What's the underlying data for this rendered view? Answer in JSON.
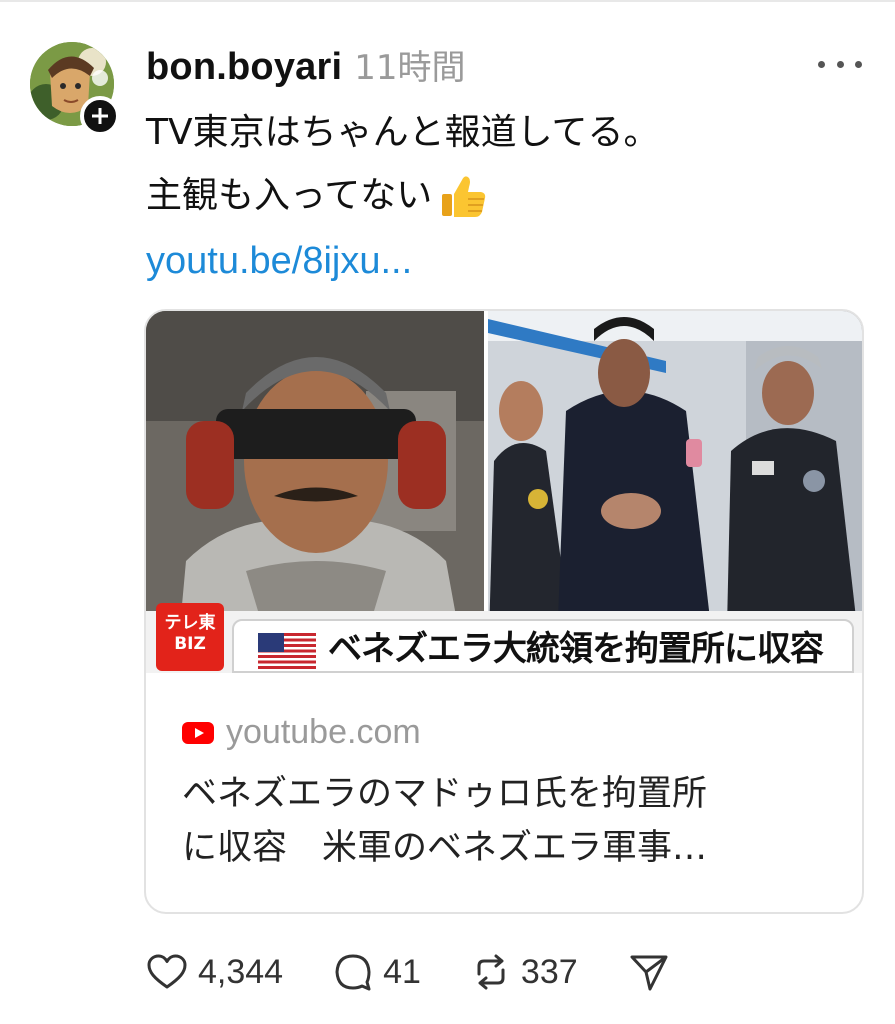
{
  "post": {
    "username": "bon.boyari",
    "timestamp": "11時間",
    "text_line1": "TV東京はちゃんと報道してる。",
    "text_line2": "主観も入ってない",
    "link_text": "youtu.be/8ijxu...",
    "emoji": "thumbs-up-icon"
  },
  "card": {
    "channel_logo_line1": "テレ東",
    "channel_logo_line2": "BIZ",
    "headline": "ベネズエラ大統領を拘置所に収容",
    "source": "youtube.com",
    "title_line1": "ベネズエラのマドゥロ氏を拘置所",
    "title_line2": "に収容　米軍のベネズエラ軍事…"
  },
  "actions": {
    "likes": "4,344",
    "comments": "41",
    "reposts": "337"
  },
  "colors": {
    "link": "#1d8ad8",
    "muted": "#9a9a9a",
    "tvtokyo_red": "#e2231a",
    "youtube_red": "#ff0000"
  }
}
